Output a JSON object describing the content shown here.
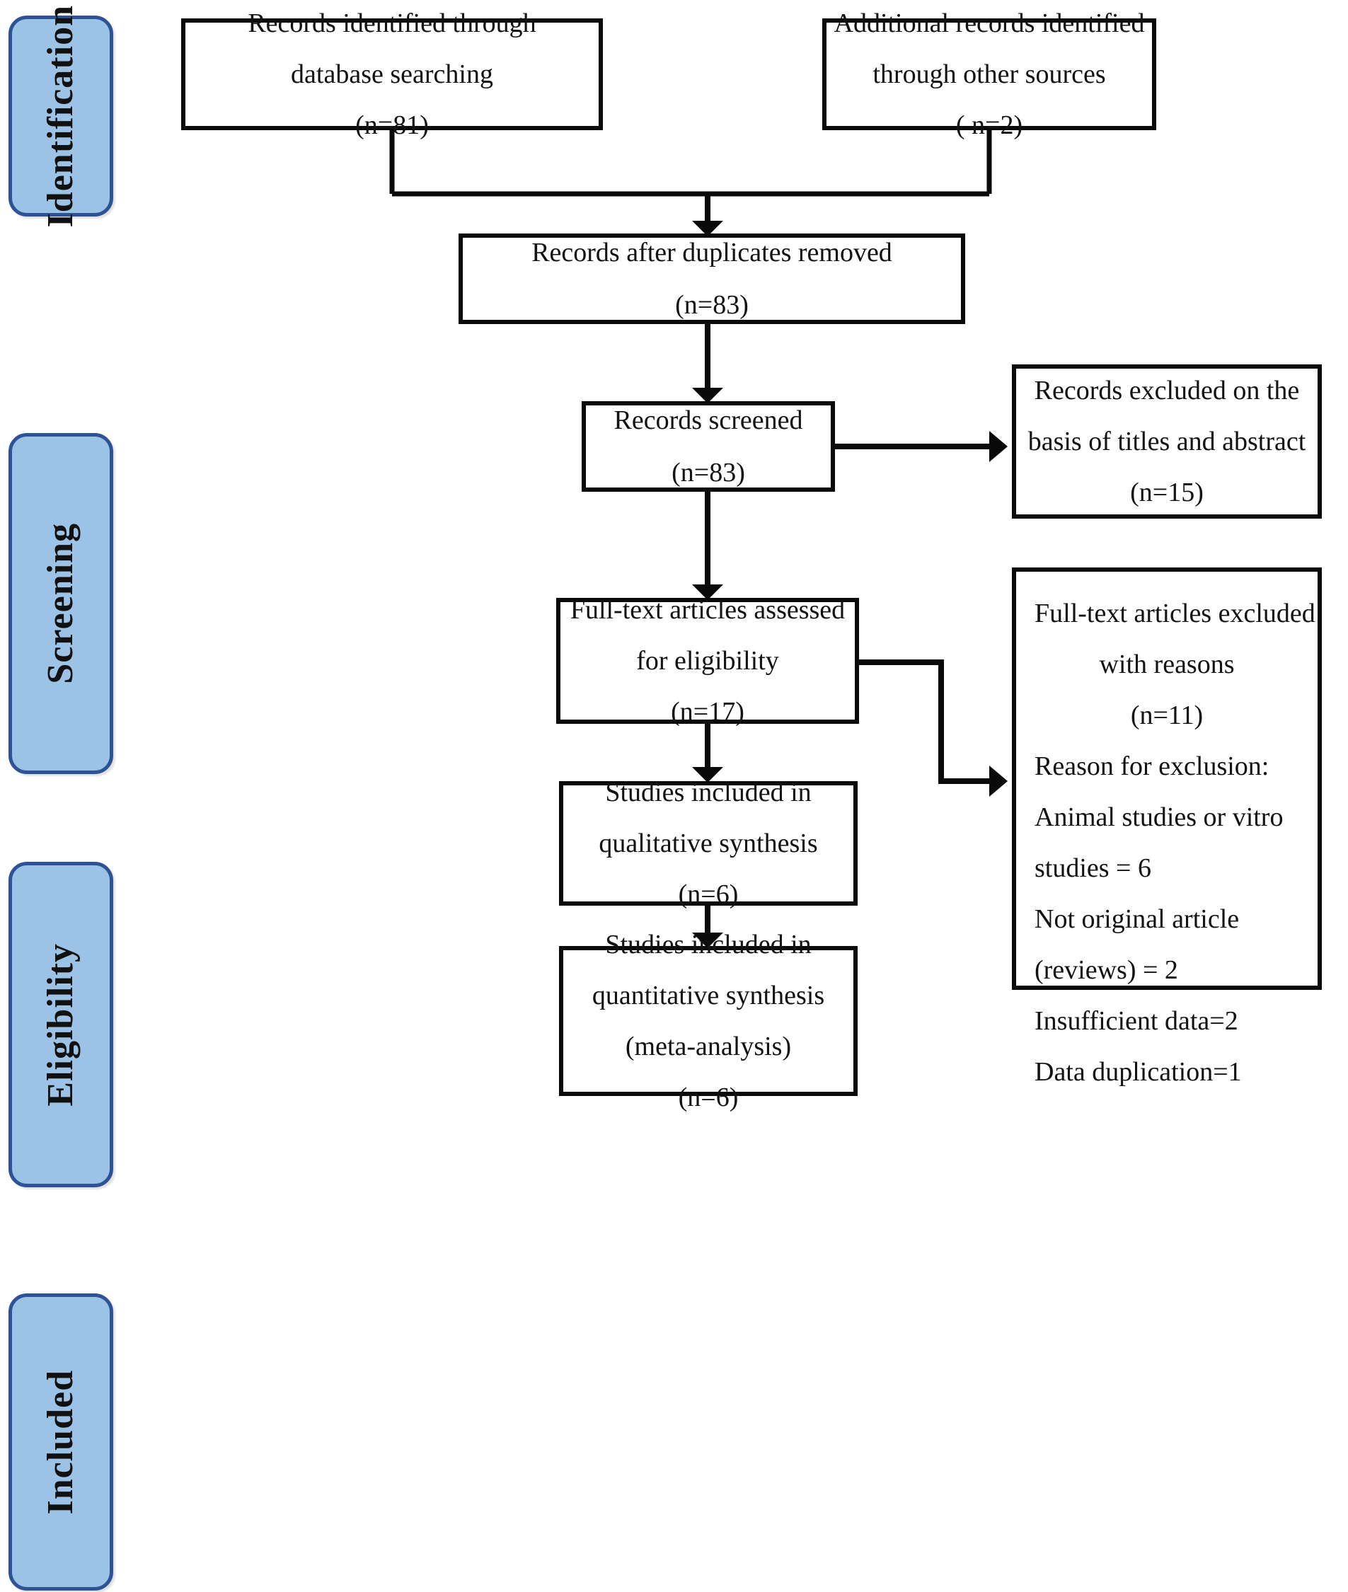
{
  "figure": {
    "type": "prisma-flow-diagram",
    "colors": {
      "stage_tab_fill": "#9CC3E5",
      "stage_tab_border": "#2E5395",
      "box_border": "#0A0A0A",
      "box_fill": "#FFFFFF",
      "text": "#121212"
    }
  },
  "stages": [
    {
      "id": "identification",
      "label": "Identification"
    },
    {
      "id": "screening",
      "label": "Screening"
    },
    {
      "id": "eligibility",
      "label": "Eligibility"
    },
    {
      "id": "included",
      "label": "Included"
    }
  ],
  "boxes": {
    "records_database": {
      "lines": [
        "Records identified through",
        "database searching",
        "(n=81)"
      ],
      "count": 81
    },
    "records_other_sources": {
      "lines": [
        "Additional records identified",
        "through other sources",
        "( n=2)"
      ],
      "count": 2
    },
    "records_after_duplicates": {
      "lines": [
        "Records after duplicates removed",
        "(n=83)"
      ],
      "count": 83
    },
    "records_screened": {
      "lines": [
        "Records screened",
        "(n=83)"
      ],
      "count": 83
    },
    "records_excluded_titles": {
      "lines": [
        "Records excluded on the",
        "basis of titles and abstract",
        "(n=15)"
      ],
      "count": 15
    },
    "fulltext_assessed": {
      "lines": [
        "Full-text articles assessed",
        "for eligibility",
        "(n=17)"
      ],
      "count": 17
    },
    "fulltext_excluded": {
      "header_lines": [
        "Full-text articles excluded",
        "with reasons",
        "(n=11)"
      ],
      "count": 11,
      "reason_lines": [
        "Reason for exclusion:",
        "Animal studies or vitro",
        "studies = 6",
        "Not original article",
        "(reviews) = 2",
        "Insufficient data=2",
        "Data duplication=1"
      ],
      "reasons": [
        {
          "label": "Animal studies or vitro studies",
          "value": 6
        },
        {
          "label": "Not original article (reviews)",
          "value": 2
        },
        {
          "label": "Insufficient data",
          "value": 2
        },
        {
          "label": "Data duplication",
          "value": 1
        }
      ]
    },
    "qualitative_synthesis": {
      "lines": [
        "Studies included in",
        "qualitative synthesis",
        "(n=6)"
      ],
      "count": 6
    },
    "quantitative_synthesis": {
      "lines": [
        "Studies included in",
        "quantitative synthesis",
        "(meta-analysis)",
        "(n=6)"
      ],
      "count": 6
    }
  }
}
